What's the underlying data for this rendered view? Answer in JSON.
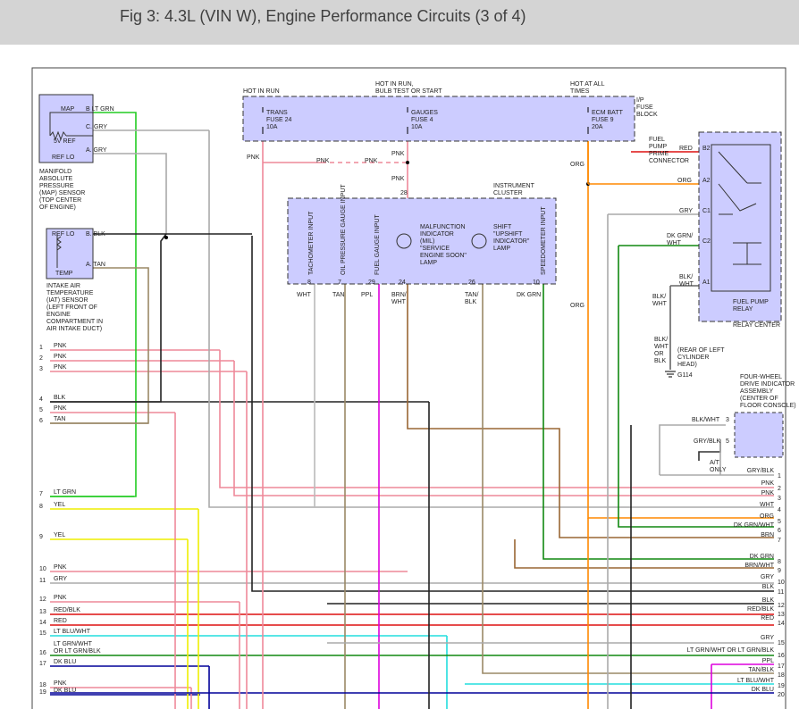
{
  "title": "Fig 3: 4.3L (VIN W), Engine Performance Circuits (3 of 4)",
  "colors": {
    "lt_grn": "#22cc22",
    "dk_grn": "#118811",
    "pnk": "#ee8899",
    "gry": "#aaaaaa",
    "blk": "#222222",
    "tan": "#9a8866",
    "yel": "#eeee00",
    "red": "#dd1111",
    "org": "#ff8800",
    "ppl": "#dd00dd",
    "brn": "#996633",
    "lt_blu": "#22dddd",
    "dk_blu": "#000099",
    "box_fill": "#ccccff"
  },
  "fuse_block": {
    "hot_in_run": "HOT IN RUN",
    "hot_in_run_bulb": [
      "HOT IN RUN,",
      "BULB TEST OR START"
    ],
    "hot_at_all": [
      "HOT AT ALL",
      "TIMES"
    ],
    "label": [
      "I/P",
      "FUSE",
      "BLOCK"
    ],
    "fuse_trans": [
      "TRANS",
      "FUSE 24",
      "10A"
    ],
    "fuse_gauges": [
      "GAUGES",
      "FUSE 4",
      "10A"
    ],
    "fuse_ecm": [
      "ECM BATT",
      "FUSE 9",
      "20A"
    ]
  },
  "map_sensor": {
    "pins": [
      "MAP",
      "5V REF",
      "REF LO"
    ],
    "terms": [
      "B",
      "C",
      "A"
    ],
    "wires": [
      "LT GRN",
      "GRY",
      "GRY"
    ],
    "desc": [
      "MANIFOLD",
      "ABSOLUTE",
      "PRESSURE",
      "(MAP) SENSOR",
      "(TOP CENTER",
      "OF ENGINE)"
    ]
  },
  "iat_sensor": {
    "pins": [
      "REF LO",
      "TEMP"
    ],
    "terms": [
      "B",
      "A"
    ],
    "wires": [
      "BLK",
      "TAN"
    ],
    "desc": [
      "INTAKE AIR",
      "TEMPERATURE",
      "(IAT) SENSOR",
      "(LEFT FRONT OF",
      "ENGINE",
      "COMPARTMENT IN",
      "AIR INTAKE DUCT)"
    ]
  },
  "cluster": {
    "title": [
      "INSTRUMENT",
      "CLUSTER"
    ],
    "inputs": [
      "TACHOMETER INPUT",
      "OIL PRESSURE GAUGE INPUT",
      "FUEL GAUGE INPUT",
      "SPEEDOMETER INPUT"
    ],
    "mil": [
      "MALFUNCTION",
      "INDICATOR",
      "(MIL)",
      "\"SERVICE",
      "ENGINE SOON\"",
      "LAMP"
    ],
    "shift": [
      "SHIFT",
      "\"UPSHIFT",
      "INDICATOR\"",
      "LAMP"
    ],
    "pins": [
      "8",
      "7",
      "29",
      "24",
      "26",
      "10",
      "28"
    ],
    "wires": [
      "WHT",
      "TAN",
      "PPL",
      "BRN/",
      "WHT",
      "TAN/",
      "BLK",
      "DK GRN"
    ]
  },
  "relay": {
    "prime": [
      "FUEL",
      "PUMP",
      "PRIME",
      "CONNECTOR"
    ],
    "pins": [
      "B2",
      "A2",
      "C1",
      "C2",
      "A1"
    ],
    "wires": [
      "RED",
      "ORG",
      "GRY",
      "DK GRN/",
      "WHT",
      "BLK/",
      "WHT"
    ],
    "label": [
      "FUEL PUMP",
      "RELAY"
    ],
    "center": "RELAY CENTER"
  },
  "ground": {
    "wire": [
      "BLK/",
      "WHT",
      "OR",
      "BLK"
    ],
    "desc": [
      "(REAR OF LEFT",
      "CYLINDER",
      "HEAD)"
    ],
    "id": "G114"
  },
  "fourwd": {
    "desc": [
      "FOUR-WHEEL",
      "DRIVE INDICATOR",
      "ASSEMBLY",
      "(CENTER OF",
      "FLOOR CONSOLE)"
    ],
    "pins": [
      "3",
      "5"
    ],
    "wires": [
      "BLK/WHT",
      "GRY/BLK"
    ],
    "at_only": [
      "A/T",
      "ONLY"
    ]
  },
  "misc_labels": {
    "pnk": "PNK",
    "org": "ORG",
    "blk_wht": [
      "BLK/",
      "WHT"
    ]
  },
  "left_rows": [
    {
      "n": "1",
      "c": "PNK"
    },
    {
      "n": "2",
      "c": "PNK"
    },
    {
      "n": "3",
      "c": "PNK"
    },
    {
      "n": "4",
      "c": "BLK"
    },
    {
      "n": "5",
      "c": "PNK"
    },
    {
      "n": "6",
      "c": "TAN"
    },
    {
      "n": "7",
      "c": "LT GRN"
    },
    {
      "n": "8",
      "c": "YEL"
    },
    {
      "n": "9",
      "c": "YEL"
    },
    {
      "n": "10",
      "c": "PNK"
    },
    {
      "n": "11",
      "c": "GRY"
    },
    {
      "n": "12",
      "c": "PNK"
    },
    {
      "n": "13",
      "c": "RED/BLK"
    },
    {
      "n": "14",
      "c": "RED"
    },
    {
      "n": "15",
      "c": "LT BLU/WHT"
    },
    {
      "n": "16",
      "c": "LT GRN/WHT\nOR LT GRN/BLK"
    },
    {
      "n": "17",
      "c": "DK BLU"
    },
    {
      "n": "18",
      "c": "PNK"
    },
    {
      "n": "19",
      "c": "DK BLU"
    }
  ],
  "right_rows": [
    {
      "n": "1",
      "c": "GRY/BLK"
    },
    {
      "n": "2",
      "c": "PNK"
    },
    {
      "n": "3",
      "c": "PNK"
    },
    {
      "n": "4",
      "c": "WHT"
    },
    {
      "n": "5",
      "c": "ORG"
    },
    {
      "n": "6",
      "c": "DK GRN/WHT"
    },
    {
      "n": "7",
      "c": "BRN"
    },
    {
      "n": "8",
      "c": "DK GRN"
    },
    {
      "n": "9",
      "c": "BRN/WHT"
    },
    {
      "n": "10",
      "c": "GRY"
    },
    {
      "n": "11",
      "c": "BLK"
    },
    {
      "n": "12",
      "c": "BLK"
    },
    {
      "n": "13",
      "c": "RED/BLK"
    },
    {
      "n": "14",
      "c": "RED"
    },
    {
      "n": "15",
      "c": "GRY"
    },
    {
      "n": "16",
      "c": "LT GRN/WHT  OR  LT GRN/BLK"
    },
    {
      "n": "17",
      "c": "PPL"
    },
    {
      "n": "18",
      "c": "TAN/BLK"
    },
    {
      "n": "19",
      "c": "LT BLU/WHT"
    },
    {
      "n": "20",
      "c": "DK BLU"
    }
  ]
}
